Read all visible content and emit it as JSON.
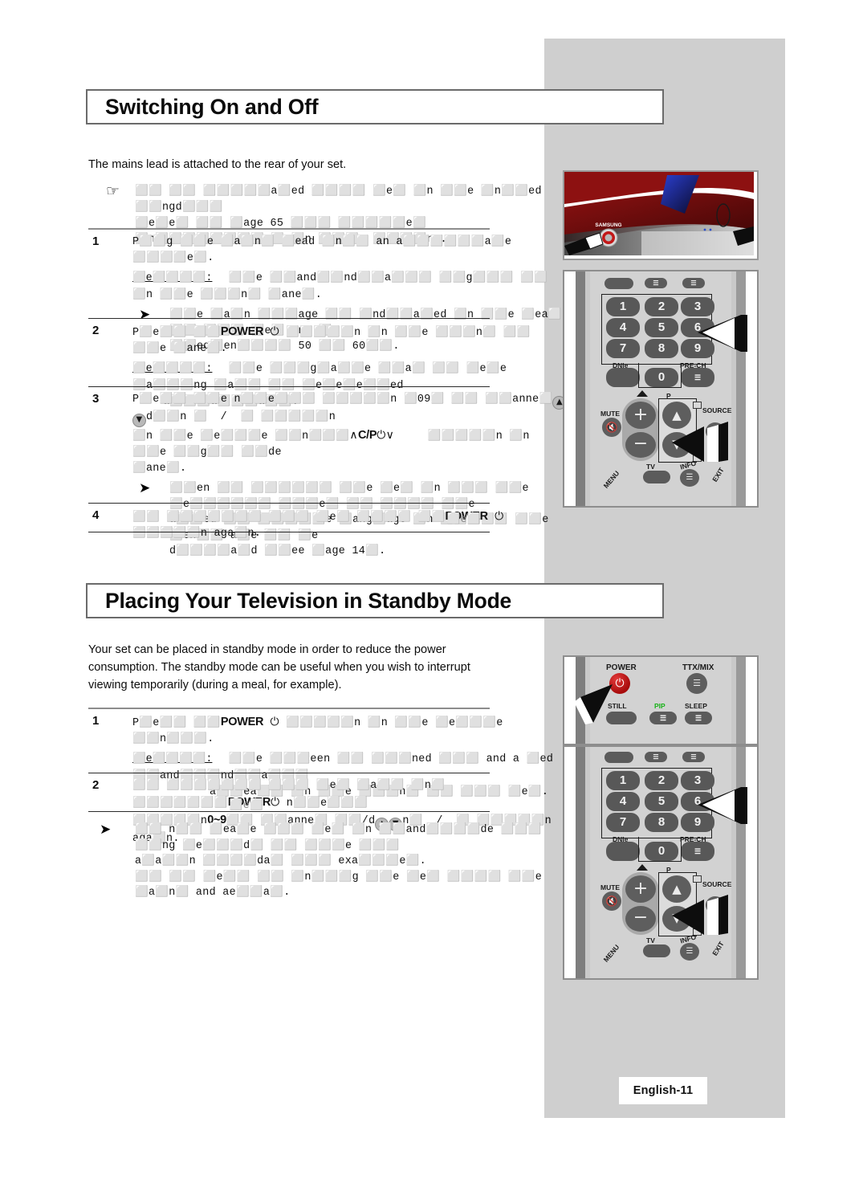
{
  "page": {
    "footer_label": "English-11",
    "background": "#ffffff",
    "panel_color": "#cfcfcf"
  },
  "sections": [
    {
      "heading": "Switching On and Off",
      "lead": "The mains lead is attached to the rear of your set.",
      "hand_note": {
        "line1": "⬜⬜ ⬜⬜ ⬜⬜⬜⬜⬜a⬜ed ⬜⬜⬜⬜ ⬜e⬜ ⬜n ⬜⬜e ⬜n⬜⬜ed ⬜⬜ngd⬜⬜⬜",
        "line2": "⬜e⬜e⬜ ⬜⬜ ⬜age 65 ⬜⬜⬜ ⬜⬜⬜⬜⬜e⬜ ⬜n⬜⬜⬜⬜⬜⬜⬜⬜n⬜ ⬜n ⬜⬜⬜g ⬜⬜⬜⬜ng."
      },
      "steps": [
        {
          "num": "1",
          "line": "P⬜⬜g ⬜⬜e ⬜a⬜n⬜ ⬜ead ⬜n⬜⬜ an a⬜⬜⬜⬜⬜⬜a⬜e ⬜⬜⬜⬜e⬜.",
          "result_label": "⬜e⬜⬜⬜⬜:",
          "result_text": "⬜⬜e ⬜⬜and⬜⬜nd⬜⬜a⬜⬜⬜ ⬜⬜g⬜⬜⬜ ⬜⬜ ⬜n ⬜⬜e ⬜⬜⬜n⬜ ⬜ane⬜.",
          "arrow_notes": [
            "⬜⬜e ⬜a⬜n ⬜⬜⬜age ⬜⬜ ⬜nd⬜⬜a⬜ed ⬜n ⬜⬜e ⬜ea⬜ ⬜⬜ ⬜⬜⬜ ⬜e⬜ and ⬜",
            "⬜⬜eq⬜en⬜⬜⬜⬜ 50 ⬜⬜ 60⬜⬜."
          ]
        },
        {
          "num": "2",
          "line_pre": "P⬜e⬜⬜ ⬜⬜",
          "key": "POWER",
          "line_post": " ⬜⬜⬜⬜⬜n ⬜n ⬜⬜e ⬜⬜⬜n⬜ ⬜⬜ ⬜⬜e ⬜ane⬜.",
          "result_label": "⬜e⬜⬜⬜⬜:",
          "result_text": "⬜⬜e ⬜⬜⬜g⬜a⬜⬜e ⬜⬜a⬜ ⬜⬜ ⬜e⬜e ⬜a⬜⬜⬜ng ⬜a⬜⬜ ⬜⬜ ⬜e⬜e⬜e⬜⬜ed",
          "result_text2": "a⬜⬜⬜a⬜⬜⬜a⬜⬜."
        },
        {
          "num": "3",
          "line1a": "P⬜e⬜⬜ ⬜⬜e n⬜⬜e⬜⬜⬜ ⬜⬜⬜⬜⬜n ⬜0",
          "line1b": "9⬜ ⬜⬜ ⬜⬜anne⬜",
          "line1c": "d⬜⬜n ⬜  /  ⬜ ⬜⬜⬜⬜⬜n",
          "line2a": "⬜n ⬜⬜e ⬜e⬜⬜⬜e ⬜⬜n⬜⬜⬜",
          "line2key": "C/P",
          "line2b": "⬜⬜⬜⬜⬜n ⬜n ⬜⬜e ⬜⬜g⬜⬜ ⬜⬜de",
          "line3": "⬜ane⬜.",
          "arrow_notes": [
            "⬜⬜en ⬜⬜ ⬜⬜⬜⬜⬜⬜ ⬜⬜e ⬜e⬜ ⬜n ⬜⬜⬜ ⬜⬜e ⬜e⬜⬜⬜⬜⬜⬜ ⬜⬜⬜e⬜ ⬜⬜ ⬜⬜⬜⬜ ⬜⬜e",
            "a⬜⬜ed ⬜⬜ ⬜⬜⬜⬜⬜e ⬜ang⬜age ⬜n ⬜⬜⬜⬜⬜ ⬜⬜e ⬜en⬜⬜ a⬜e ⬜⬜ ⬜e",
            "d⬜⬜⬜⬜a⬜d ⬜⬜ee ⬜age 14⬜."
          ]
        },
        {
          "num": "4",
          "line_pre": "⬜⬜ ⬜⬜⬜⬜⬜⬜⬜ ⬜⬜⬜ ⬜e⬜ ⬜⬜⬜⬜ ⬜⬜",
          "key": "POWER",
          "ghost": "⬜e⬜",
          "line_post": " ⬜⬜⬜⬜⬜n aga⬜n."
        }
      ]
    },
    {
      "heading": "Placing Your Television in Standby Mode",
      "lead": "Your set can be placed in standby mode in order to reduce the power consumption. The standby mode can be useful when you wish to interrupt viewing temporarily (during a meal, for example).",
      "steps": [
        {
          "num": "1",
          "line_pre": "P⬜e⬜⬜ ⬜⬜",
          "key": "POWER",
          "line_post": " ⬜⬜⬜⬜⬜n ⬜n ⬜⬜e ⬜e⬜⬜⬜e ⬜⬜n⬜⬜⬜.",
          "result_label": "⬜e⬜⬜⬜⬜:",
          "result_text": "⬜⬜e ⬜⬜⬜een ⬜⬜ ⬜⬜⬜ned ⬜⬜⬜ and a ⬜ed ⬜⬜and⬜⬜⬜nd⬜⬜a⬜⬜⬜",
          "result_text2": "a⬜⬜ea⬜⬜ ⬜n ⬜⬜e ⬜⬜⬜n⬜ ⬜⬜ ⬜⬜⬜ ⬜e⬜."
        },
        {
          "num": "2",
          "line1a": "⬜⬜ ⬜⬜⬜⬜⬜⬜⬜ ⬜⬜⬜ ⬜e⬜ ⬜a⬜⬜ ⬜n⬜ ⬜⬜⬜⬜⬜⬜⬜",
          "key": "POWER",
          "ghost": "⬜e⬜",
          "line1b": " n⬜⬜e⬜⬜⬜",
          "line2a": "⬜⬜⬜⬜⬜n",
          "key2": "0~9",
          "line2b": "⬜⬜ ⬜⬜anne⬜ ⬜⬜/d",
          "line2c": "n⬜  /  ⬜ ⬜⬜⬜⬜⬜n aga⬜n."
        }
      ],
      "arrow_notes": [
        "⬜⬜ n⬜⬜ ⬜ea⬜e ⬜⬜⬜ ⬜e⬜ ⬜n ⬜⬜and⬜⬜⬜⬜de ⬜⬜⬜ ⬜⬜ng ⬜e⬜⬜⬜d⬜ ⬜⬜ ⬜⬜⬜e ⬜⬜⬜",
        "a⬜a⬜⬜n ⬜⬜⬜⬜da⬜ ⬜⬜⬜ exa⬜⬜⬜e⬜.",
        "⬜⬜ ⬜⬜ ⬜e⬜⬜ ⬜⬜ ⬜n⬜⬜⬜g ⬜⬜e ⬜e⬜ ⬜⬜⬜⬜ ⬜⬜e ⬜a⬜n⬜ and ae⬜⬜a⬜."
      ]
    }
  ],
  "illustrations": {
    "tv": {
      "brand_label": "SAMSUNG",
      "colors": {
        "body_red": "#8d1111",
        "accent_blue": "#1b2f9c"
      }
    },
    "remote_power_row": {
      "power_label": "POWER",
      "ttx_label": "TTX/MIX",
      "still_label": "STILL",
      "pip_label": "PIP",
      "sleep_label": "SLEEP",
      "pip_color": "#17b317",
      "power_button_color": "#b91212"
    },
    "remote_keypad": {
      "numbers": [
        "1",
        "2",
        "3",
        "4",
        "5",
        "6",
        "7",
        "8",
        "9"
      ],
      "zero": "0",
      "dnie_label": "DNIe",
      "prech_label": "PRE-CH",
      "mute_label": "MUTE",
      "source_label": "SOURCE",
      "p_label": "P",
      "tv_label": "TV",
      "info_label": "INFO",
      "exit_label": "EXIT",
      "menu_label": "MENU"
    }
  }
}
